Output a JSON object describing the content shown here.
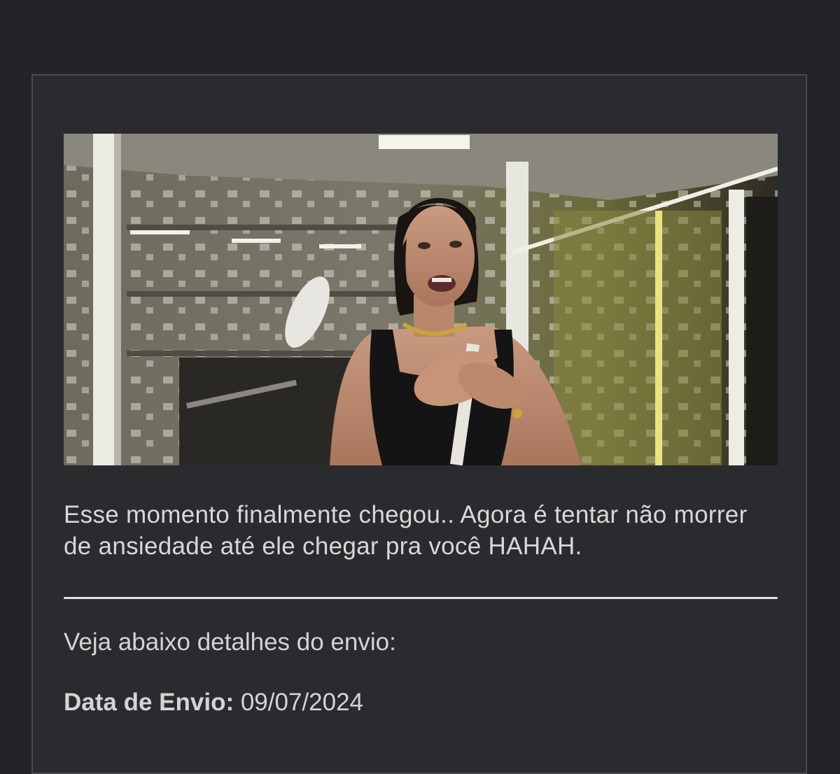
{
  "email": {
    "message": "Esse momento finalmente chegou.. Agora é tentar não morrer de ansiedade até ele chegar pra você HAHAH.",
    "details_intro": "Veja abaixo detalhes do envio:",
    "details": {
      "send_date_label": "Data de Envio:",
      "send_date_value": "09/07/2024"
    },
    "hero_image": "crying-woman-gif"
  },
  "colors": {
    "page_background": "#232427",
    "card_background": "#2a2b2e",
    "text": "#d4d4d4",
    "divider": "#e3e3e3"
  }
}
